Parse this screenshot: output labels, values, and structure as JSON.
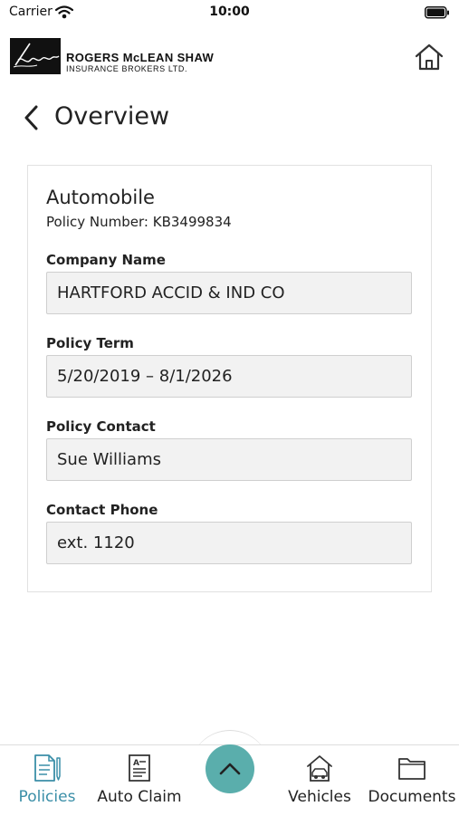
{
  "status_bar": {
    "carrier": "Carrier",
    "time": "10:00"
  },
  "brand": {
    "name_line1": "ROGERS McLEAN SHAW",
    "name_line2": "INSURANCE BROKERS LTD."
  },
  "header": {
    "title": "Overview"
  },
  "policy": {
    "type": "Automobile",
    "number_line": "Policy Number: KB3499834",
    "fields": [
      {
        "label": "Company Name",
        "value": "HARTFORD ACCID & IND CO"
      },
      {
        "label": "Policy Term",
        "value": "5/20/2019 – 8/1/2026"
      },
      {
        "label": "Policy Contact",
        "value": "Sue Williams"
      },
      {
        "label": "Contact Phone",
        "value": "ext. 1120"
      }
    ]
  },
  "tabs": [
    {
      "label": "Policies",
      "icon": "policies-icon",
      "active": true
    },
    {
      "label": "Auto Claim",
      "icon": "auto-claim-icon",
      "active": false
    },
    {
      "label": "Vehicles",
      "icon": "vehicles-icon",
      "active": false
    },
    {
      "label": "Documents",
      "icon": "folder-icon",
      "active": false
    }
  ],
  "colors": {
    "accent": "#3b8fa8",
    "fab": "#5aaeac",
    "field_bg": "#f2f2f2"
  }
}
